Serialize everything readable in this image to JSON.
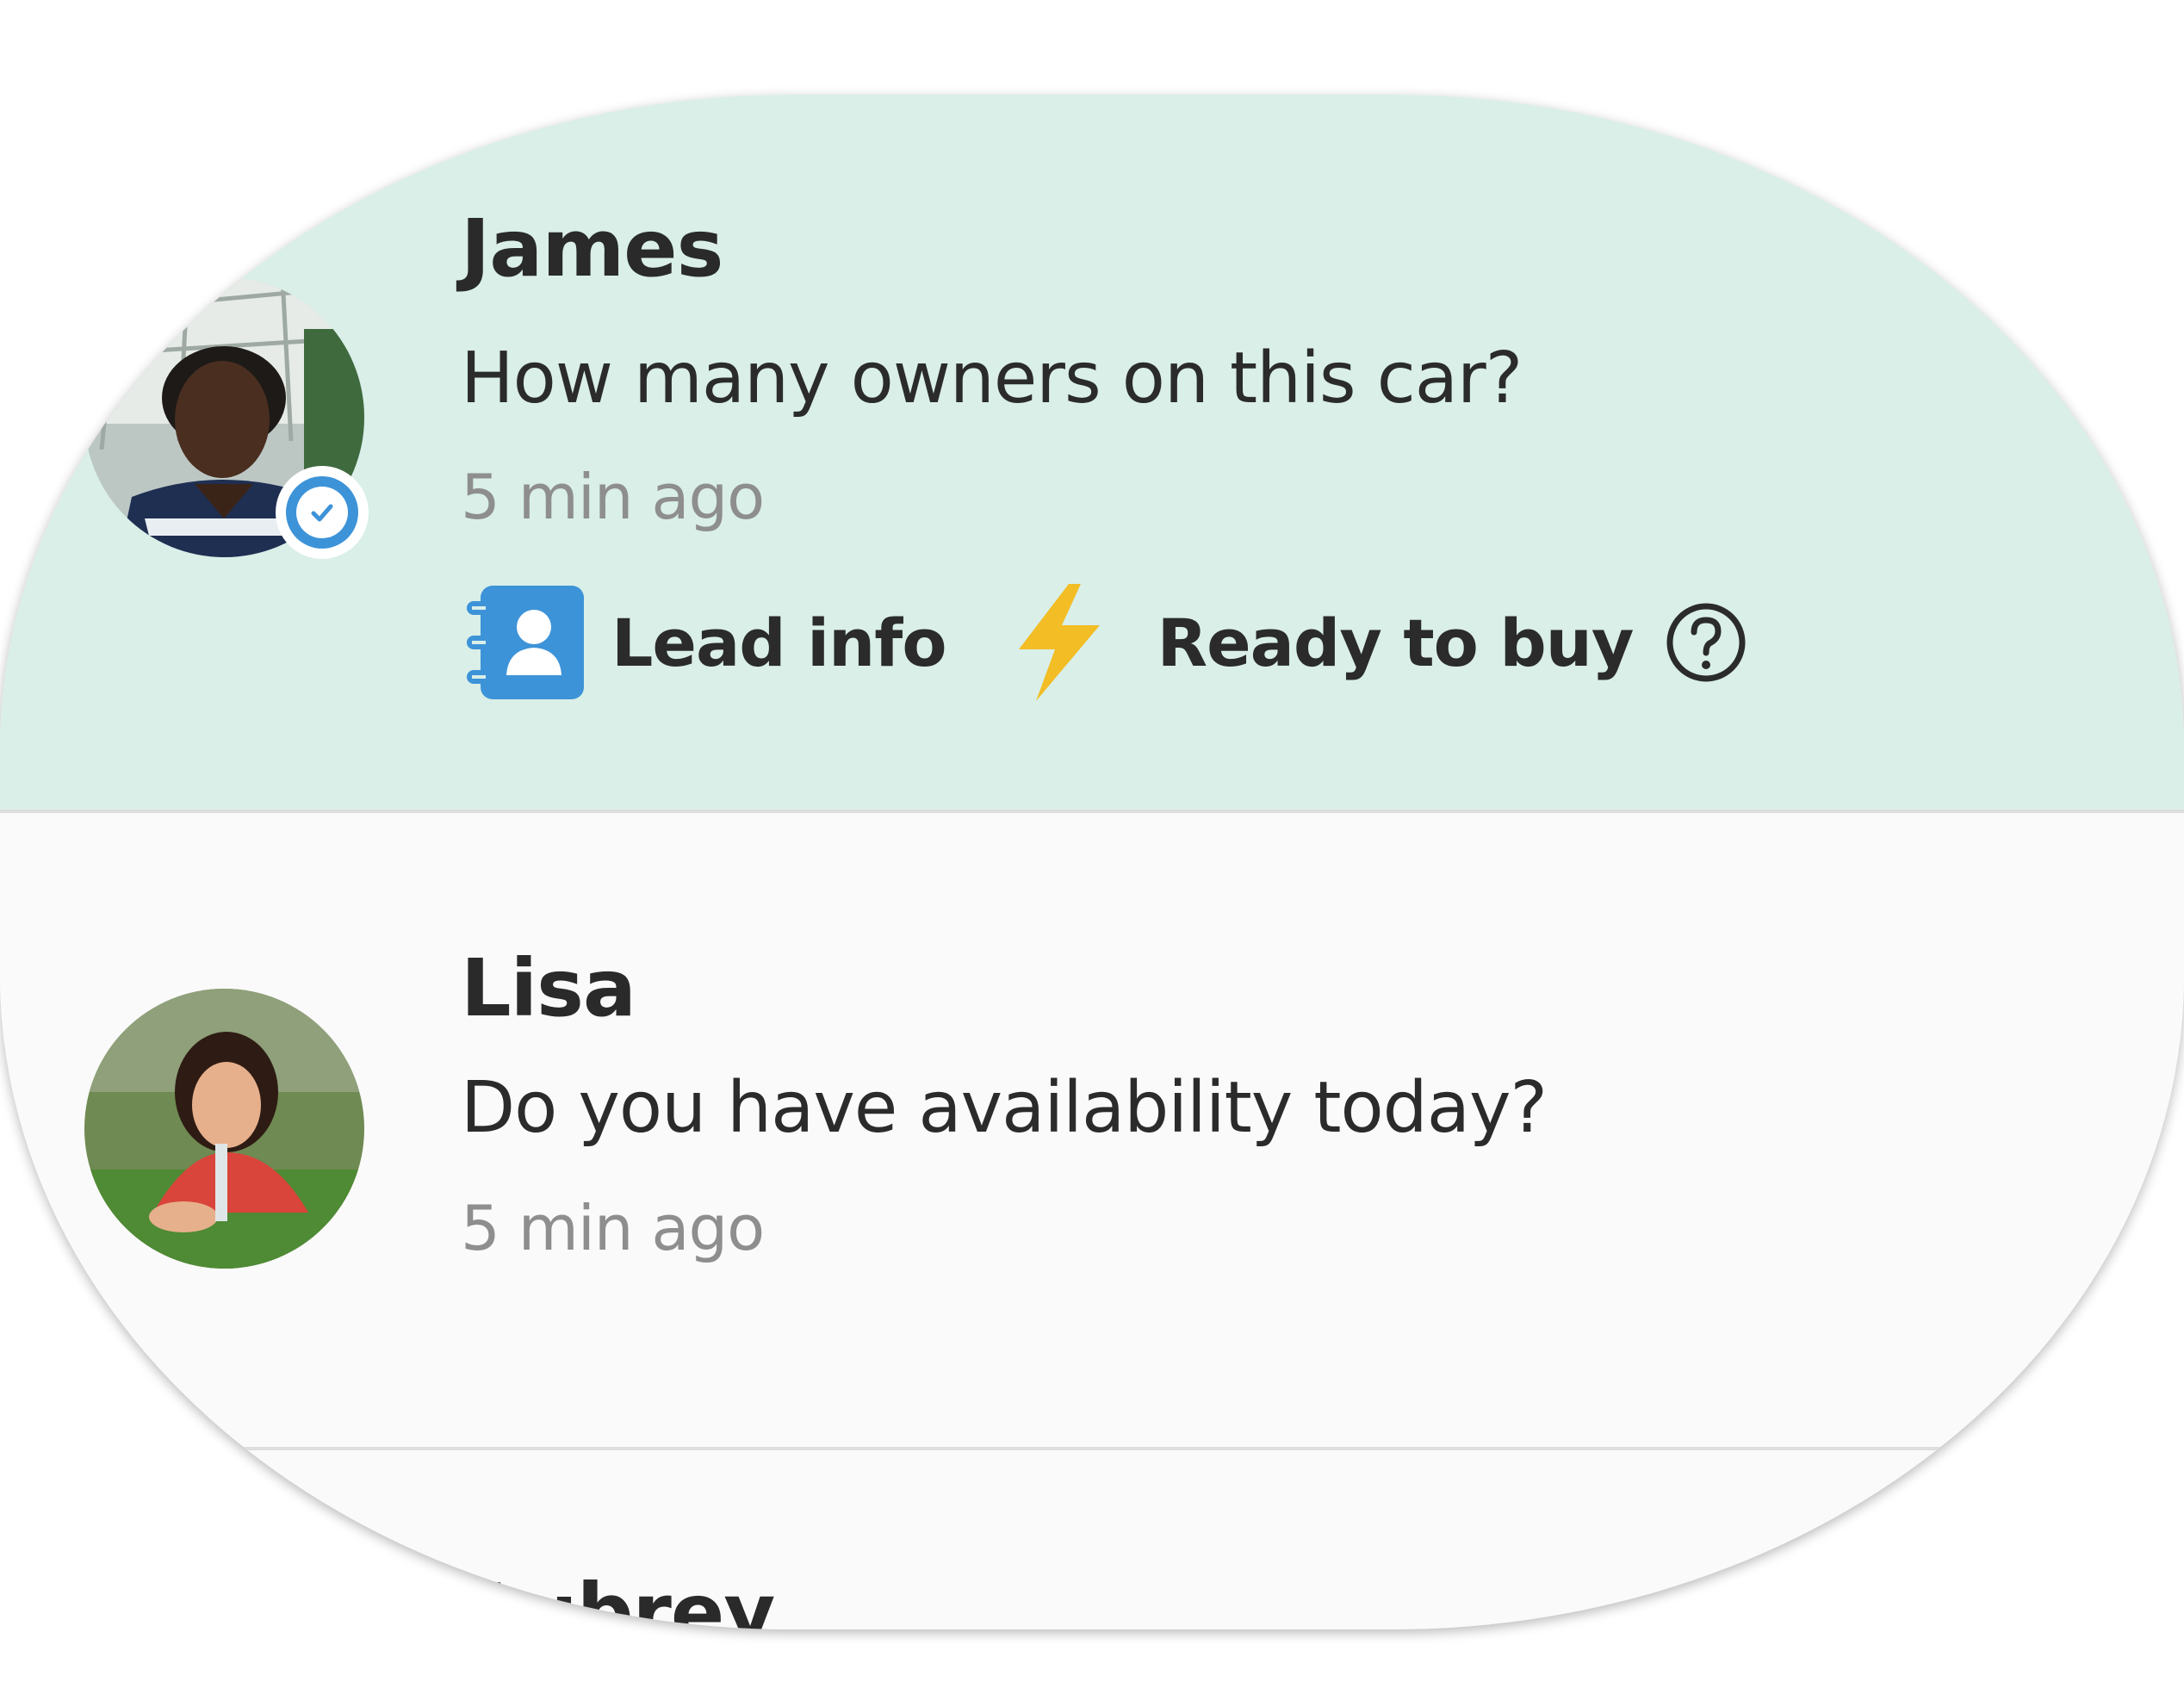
{
  "conversations": [
    {
      "name": "James",
      "message": "How many owners on this car?",
      "time": "5 min ago",
      "verified": true,
      "selected": true,
      "actions": {
        "lead_info_label": "Lead info",
        "ready_label": "Ready to buy"
      }
    },
    {
      "name": "Lisa",
      "message": "Do you have availability today?",
      "time": "5 min ago",
      "verified": false,
      "selected": false
    },
    {
      "name": "Aubrey"
    }
  ],
  "colors": {
    "selected_row_bg": "#d9efe8",
    "row_bg": "#fafafa",
    "verified_badge": "#3d93d8",
    "lead_icon": "#3d93d8",
    "bolt_icon": "#f2bd25",
    "timestamp": "#8e8e8e"
  },
  "icons": {
    "verified": "verified-check-icon",
    "lead_info": "contact-book-icon",
    "ready_to_buy": "lightning-bolt-icon",
    "help": "question-circle-icon"
  }
}
